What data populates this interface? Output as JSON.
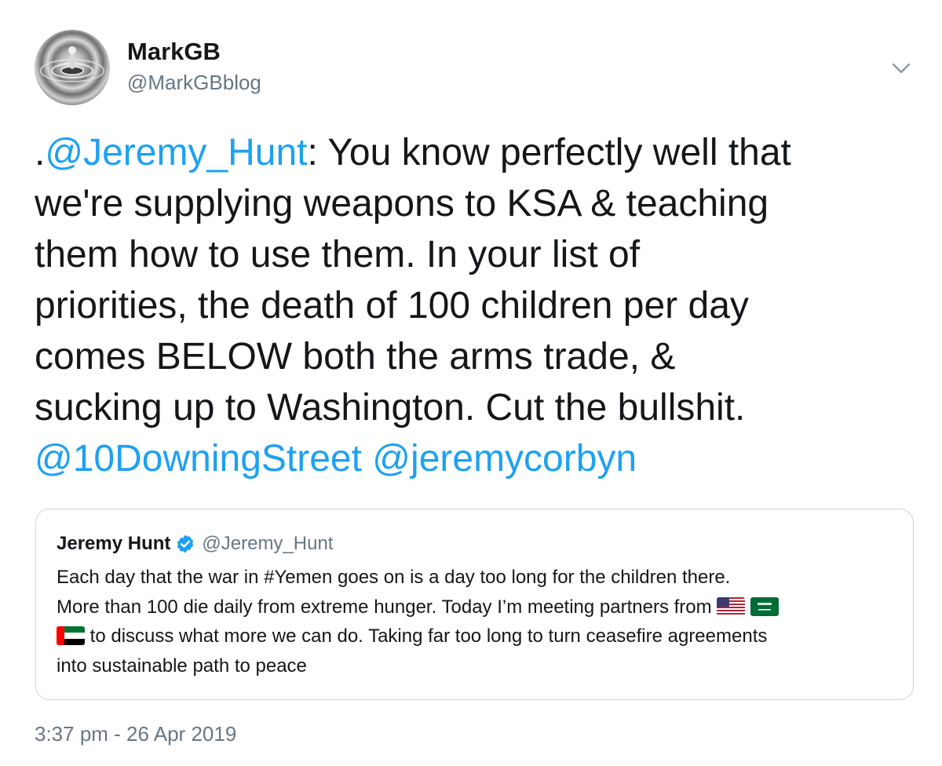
{
  "author": {
    "display_name": "MarkGB",
    "handle": "@MarkGBblog",
    "avatar_icon": "water-drop-avatar"
  },
  "menu": {
    "icon": "chevron-down-icon"
  },
  "tweet": {
    "line1_prefix": ".",
    "mention_hunt": "@Jeremy_Hunt",
    "line1_rest": ": You know perfectly well that",
    "line2": "we're supplying weapons to KSA & teaching",
    "line3": "them how to use them. In your list of",
    "line4": "priorities, the death of 100 children per day",
    "line5": "comes BELOW both the arms trade, &",
    "line6": "sucking up to Washington. Cut the bullshit.",
    "mention_downing": "@10DowningStreet",
    "mention_corbyn": "@jeremycorbyn"
  },
  "quoted": {
    "display_name": "Jeremy Hunt",
    "verified_icon": "verified-badge-icon",
    "handle": "@Jeremy_Hunt",
    "line1": "Each day that the war in #Yemen goes on is a day too long for the children there.",
    "line2": "More than 100 die daily from extreme hunger. Today I’m meeting partners from",
    "flags_line2": [
      "us-flag-icon",
      "saudi-flag-icon"
    ],
    "flags_line3": [
      "uae-flag-icon"
    ],
    "line3": "to discuss what more we can do. Taking far too long to turn ceasefire agreements",
    "line4": "into sustainable path to peace"
  },
  "timestamp": "3:37 pm - 26 Apr 2019",
  "colors": {
    "link": "#1da1f2",
    "text": "#14171a",
    "muted": "#657786",
    "border": "#ccd6dd"
  }
}
